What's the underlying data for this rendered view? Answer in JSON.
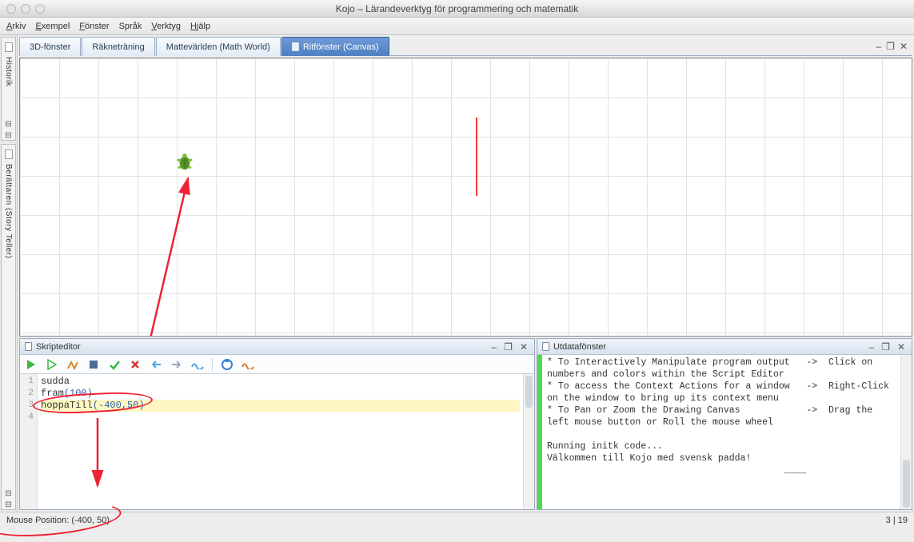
{
  "window": {
    "title": "Kojo – Lärandeverktyg för programmering och matematik"
  },
  "menus": {
    "arkiv": "Arkiv",
    "exempel": "Exempel",
    "fonster": "Fönster",
    "sprak": "Språk",
    "verktyg": "Verktyg",
    "hjalp": "Hjälp"
  },
  "sidebar": {
    "historik": "Historik",
    "storyteller": "Berättaren (Story Teller)"
  },
  "tabs": {
    "t3d": "3D-fönster",
    "rakne": "Räkneträning",
    "matte": "Mattevärlden (Math World)",
    "canvas": "Ritfönster (Canvas)"
  },
  "tabctrls": {
    "min": "–",
    "rest": "❐",
    "close": "✕"
  },
  "panels": {
    "editor": "Skripteditor",
    "output": "Utdatafönster"
  },
  "code": {
    "l1": "sudda",
    "l2_fn": "fram",
    "l2_open": "(",
    "l2_num": "100",
    "l2_close": ")",
    "l3_fn": "hoppaTill",
    "l3_open": "(",
    "l3_num": "-400,50",
    "l3_close": ")",
    "gutter": {
      "n1": "1",
      "n2": "2",
      "n3": "3",
      "n4": "4"
    }
  },
  "output_text": "* To Interactively Manipulate program output   ->  Click on numbers and colors within the Script Editor\n* To access the Context Actions for a window   ->  Right-Click on the window to bring up its context menu\n* To Pan or Zoom the Drawing Canvas            ->  Drag the left mouse button or Roll the mouse wheel\n\nRunning initk code...\nVälkommen till Kojo med svensk padda!\n                                           ____",
  "status": {
    "mouse": "Mouse Position: (-400, 50)",
    "cursor": "3 | 19"
  },
  "icons": {
    "min": "–",
    "rest": "❐",
    "close": "✕"
  }
}
